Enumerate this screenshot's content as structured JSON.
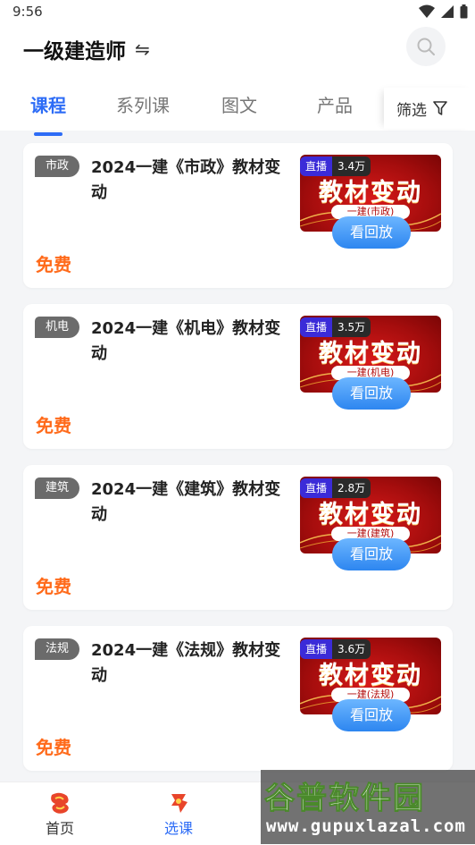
{
  "status_bar": {
    "time": "9:56"
  },
  "header": {
    "title": "一级建造师",
    "swap_symbol": "⇋"
  },
  "tabs": [
    {
      "label": "课程",
      "active": true
    },
    {
      "label": "系列课",
      "active": false
    },
    {
      "label": "图文",
      "active": false
    },
    {
      "label": "产品",
      "active": false
    }
  ],
  "filter_label": "筛选",
  "courses": [
    {
      "tag": "市政",
      "title": "2024一建《市政》教材变动",
      "price": "免费",
      "live_label": "直播",
      "views": "3.4万",
      "thumb_title": "教材变动",
      "thumb_sub": "一建(市政)",
      "replay_label": "看回放"
    },
    {
      "tag": "机电",
      "title": "2024一建《机电》教材变动",
      "price": "免费",
      "live_label": "直播",
      "views": "3.5万",
      "thumb_title": "教材变动",
      "thumb_sub": "一建(机电)",
      "replay_label": "看回放"
    },
    {
      "tag": "建筑",
      "title": "2024一建《建筑》教材变动",
      "price": "免费",
      "live_label": "直播",
      "views": "2.8万",
      "thumb_title": "教材变动",
      "thumb_sub": "一建(建筑)",
      "replay_label": "看回放"
    },
    {
      "tag": "法规",
      "title": "2024一建《法规》教材变动",
      "price": "免费",
      "live_label": "直播",
      "views": "3.6万",
      "thumb_title": "教材变动",
      "thumb_sub": "一建(法规)",
      "replay_label": "看回放"
    }
  ],
  "bottom_nav": [
    {
      "label": "首页",
      "icon": "home-icon",
      "active": false
    },
    {
      "label": "选课",
      "icon": "course-select-icon",
      "active": true
    }
  ],
  "watermark": {
    "line1": "谷普软件园",
    "line2": "www.gupuxlazal.com"
  },
  "colors": {
    "accent": "#2d6cf6",
    "price": "#ff6a1a",
    "tag_bg": "#6b6b6b",
    "thumb_red": "#c41212"
  }
}
